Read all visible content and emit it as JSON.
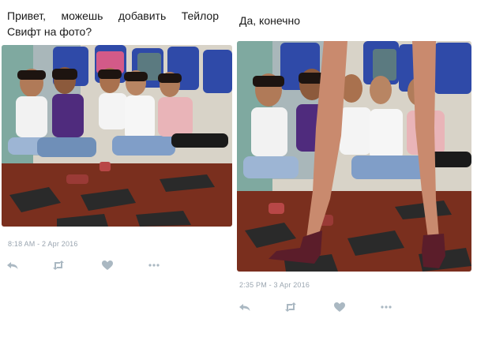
{
  "tweets": [
    {
      "text": "Привет, можешь добавить Тейлор Свифт на фото?",
      "timestamp": "8:18 AM - 2 Apr 2016",
      "photo_icon": "group-photo-image"
    },
    {
      "text": "Да, конечно",
      "timestamp": "2:35 PM - 3 Apr 2016",
      "photo_icon": "group-photo-with-legs-image"
    }
  ],
  "actions": [
    "reply-icon",
    "retweet-icon",
    "like-icon",
    "more-icon"
  ],
  "colors": {
    "text": "#1a1a1a",
    "meta": "#9aa5b0",
    "icon": "#aab8c2"
  }
}
